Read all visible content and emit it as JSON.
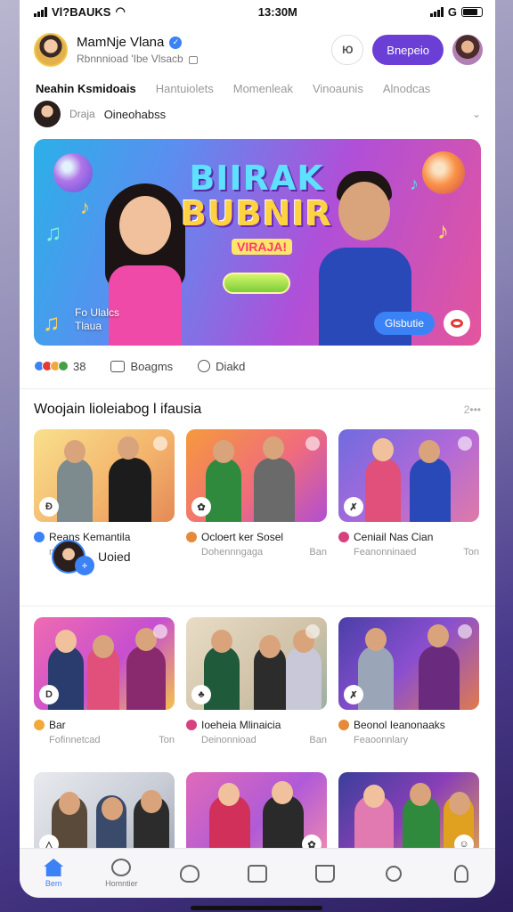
{
  "status_bar": {
    "carrier": "Vl?BAUKS",
    "time": "13:30M",
    "right_label": "G"
  },
  "profile": {
    "name": "MamNje Vlana",
    "subtitle": "Rbnnnioad 'Ibe Vlsacb"
  },
  "header": {
    "icon_button_label": "Ю",
    "primary_button_label": "Bnepeio"
  },
  "tabs": [
    {
      "label": "Neahin Ksmidoais",
      "active": true
    },
    {
      "label": "Hantuiolets",
      "active": false
    },
    {
      "label": "Momenleak",
      "active": false
    },
    {
      "label": "Vinoaunis",
      "active": false
    },
    {
      "label": "Alnodcas",
      "active": false
    }
  ],
  "account": {
    "label": "Draja",
    "name": "Oineohabss"
  },
  "banner": {
    "title_line1": "BIIRAK",
    "title_line2": "BUBNIR",
    "subtitle": "VIRAJA!",
    "caption_line1": "Fo Ulalcs",
    "caption_line2": "Tlaua",
    "button_label": "Glsbutie"
  },
  "engagement": {
    "count": "38",
    "comments_label": "Boagms",
    "share_label": "Diakd"
  },
  "section": {
    "title": "Woojain lioleiabog l ifausia",
    "see_more": "2•••"
  },
  "cards_row1": [
    {
      "title": "Reans Kemantila",
      "sub_left": "nad",
      "sub_right": "",
      "dot_color": "#3b82f6",
      "icon": "Ð"
    },
    {
      "title": "Ocloert ker Sosel",
      "sub_left": "Dohennngaga",
      "sub_right": "Ban",
      "dot_color": "#e58a3a",
      "icon": "✿"
    },
    {
      "title": "Ceniail Nas Cian",
      "sub_left": "Feanonninaed",
      "sub_right": "Ton",
      "dot_color": "#d6427e",
      "icon": "✗"
    }
  ],
  "floating_chip": {
    "label": "Uoied",
    "plus": "+"
  },
  "cards_row2": [
    {
      "title": "Bar",
      "sub_left": "Fofinnetcad",
      "sub_right": "Ton",
      "dot_color": "#f2a93b",
      "icon": "D"
    },
    {
      "title": "Ioeheia Mlinaicia",
      "sub_left": "Deinonnioad",
      "sub_right": "Ban",
      "dot_color": "#d6427e",
      "icon": "♣"
    },
    {
      "title": "Beonol Ieanonaaks",
      "sub_left": "Feaoonnlary",
      "sub_right": "",
      "dot_color": "#e58a3a",
      "icon": "✗"
    }
  ],
  "cards_row3": [
    {
      "icon": "△"
    },
    {
      "icon": "✿"
    },
    {
      "icon": "☺"
    }
  ],
  "bottom_nav": [
    {
      "label": "Bem",
      "icon": "home-icon",
      "active": true
    },
    {
      "label": "Homntier",
      "icon": "play-icon",
      "active": false
    },
    {
      "label": "",
      "icon": "heart-icon",
      "active": false
    },
    {
      "label": "",
      "icon": "square-icon",
      "active": false
    },
    {
      "label": "",
      "icon": "book-icon",
      "active": false
    },
    {
      "label": "",
      "icon": "search-icon",
      "active": false
    },
    {
      "label": "",
      "icon": "user-icon",
      "active": false
    }
  ],
  "colors": {
    "accent": "#6b3fd6",
    "link_blue": "#3b82f6",
    "background": "#ffffff"
  }
}
